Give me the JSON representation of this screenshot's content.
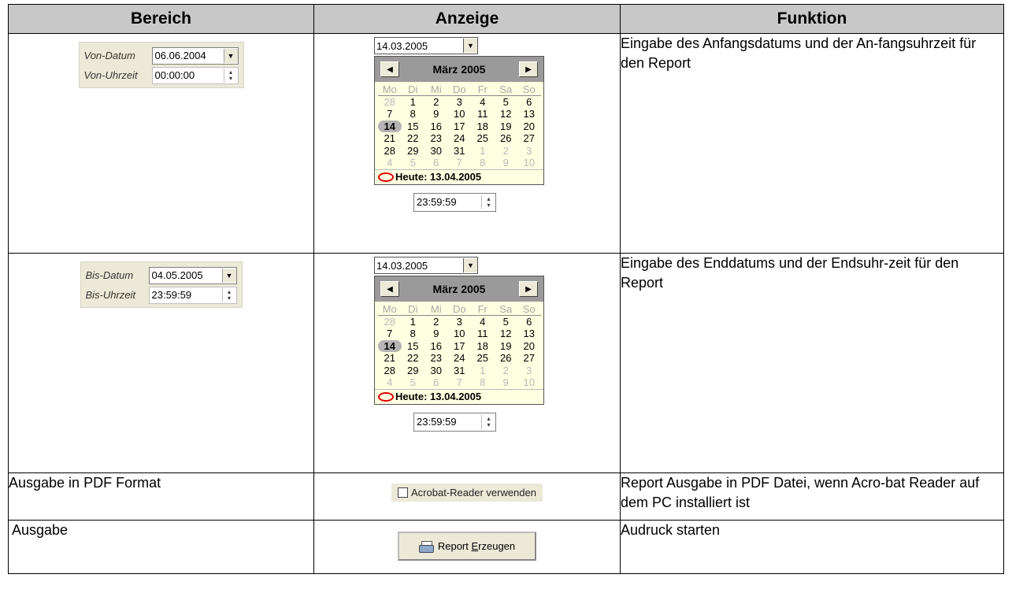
{
  "headers": {
    "bereich": "Bereich",
    "anzeige": "Anzeige",
    "funktion": "Funktion"
  },
  "row1": {
    "form": {
      "datum_label": "Von-Datum",
      "datum_value": "06.06.2004",
      "zeit_label": "Von-Uhrzeit",
      "zeit_value": "00:00:00"
    },
    "calendar": {
      "date_value": "14.03.2005",
      "month_title": "März 2005",
      "today_label": "Heute: 13.04.2005",
      "time_value": "23:59:59"
    },
    "funktion": "Eingabe des Anfangsdatums und der An-fangsuhrzeit für den Report"
  },
  "row2": {
    "form": {
      "datum_label": "Bis-Datum",
      "datum_value": "04.05.2005",
      "zeit_label": "Bis-Uhrzeit",
      "zeit_value": "23:59:59"
    },
    "calendar": {
      "date_value": "14.03.2005",
      "month_title": "März 2005",
      "today_label": "Heute: 13.04.2005",
      "time_value": "23:59:59"
    },
    "funktion": "Eingabe des Enddatums und der Endsuhr-zeit für den Report"
  },
  "calendar_grid": {
    "weekdays": [
      "Mo",
      "Di",
      "Mi",
      "Do",
      "Fr",
      "Sa",
      "So"
    ],
    "weeks": [
      [
        "28",
        "1",
        "2",
        "3",
        "4",
        "5",
        "6"
      ],
      [
        "7",
        "8",
        "9",
        "10",
        "11",
        "12",
        "13"
      ],
      [
        "14",
        "15",
        "16",
        "17",
        "18",
        "19",
        "20"
      ],
      [
        "21",
        "22",
        "23",
        "24",
        "25",
        "26",
        "27"
      ],
      [
        "28",
        "29",
        "30",
        "31",
        "1",
        "2",
        "3"
      ],
      [
        "4",
        "5",
        "6",
        "7",
        "8",
        "9",
        "10"
      ]
    ],
    "selected_day": "14"
  },
  "row3": {
    "bereich": "Ausgabe in PDF Format",
    "checkbox_label": "Acrobat-Reader verwenden",
    "funktion": "Report  Ausgabe in PDF Datei, wenn  Acro-bat Reader auf dem PC installiert ist"
  },
  "row4": {
    "bereich": " Ausgabe",
    "button_pre": "Report ",
    "button_mnemonic": "E",
    "button_post": "rzeugen",
    "funktion": "Audruck starten"
  }
}
